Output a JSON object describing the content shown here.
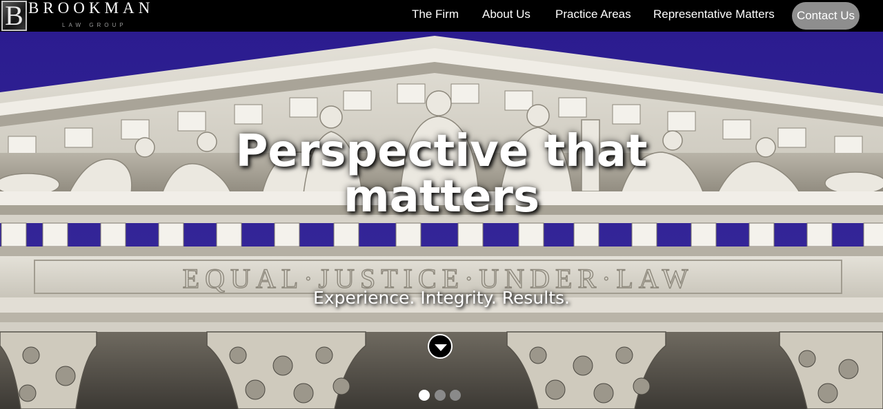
{
  "brand": {
    "monogram": "B",
    "name": "BROOKMAN",
    "subtitle": "LAW GROUP"
  },
  "nav": {
    "items": [
      {
        "label": "The Firm"
      },
      {
        "label": "About Us"
      },
      {
        "label": "Practice Areas"
      },
      {
        "label": "Representative Matters"
      }
    ],
    "contact_label": "Contact Us"
  },
  "hero": {
    "headline_line1": "Perspective that",
    "headline_line2": "matters",
    "tagline": "Experience. Integrity. Results.",
    "inscription": "EQUAL·JUSTICE·UNDER·LAW",
    "scroll_icon": "chevron-down-icon",
    "slide_count": 3,
    "active_slide": 1
  },
  "colors": {
    "sky": "#2a1f8a",
    "nav_bg": "#000000",
    "contact_bg": "#8e8e8e",
    "marble": "#d9d6cd"
  }
}
